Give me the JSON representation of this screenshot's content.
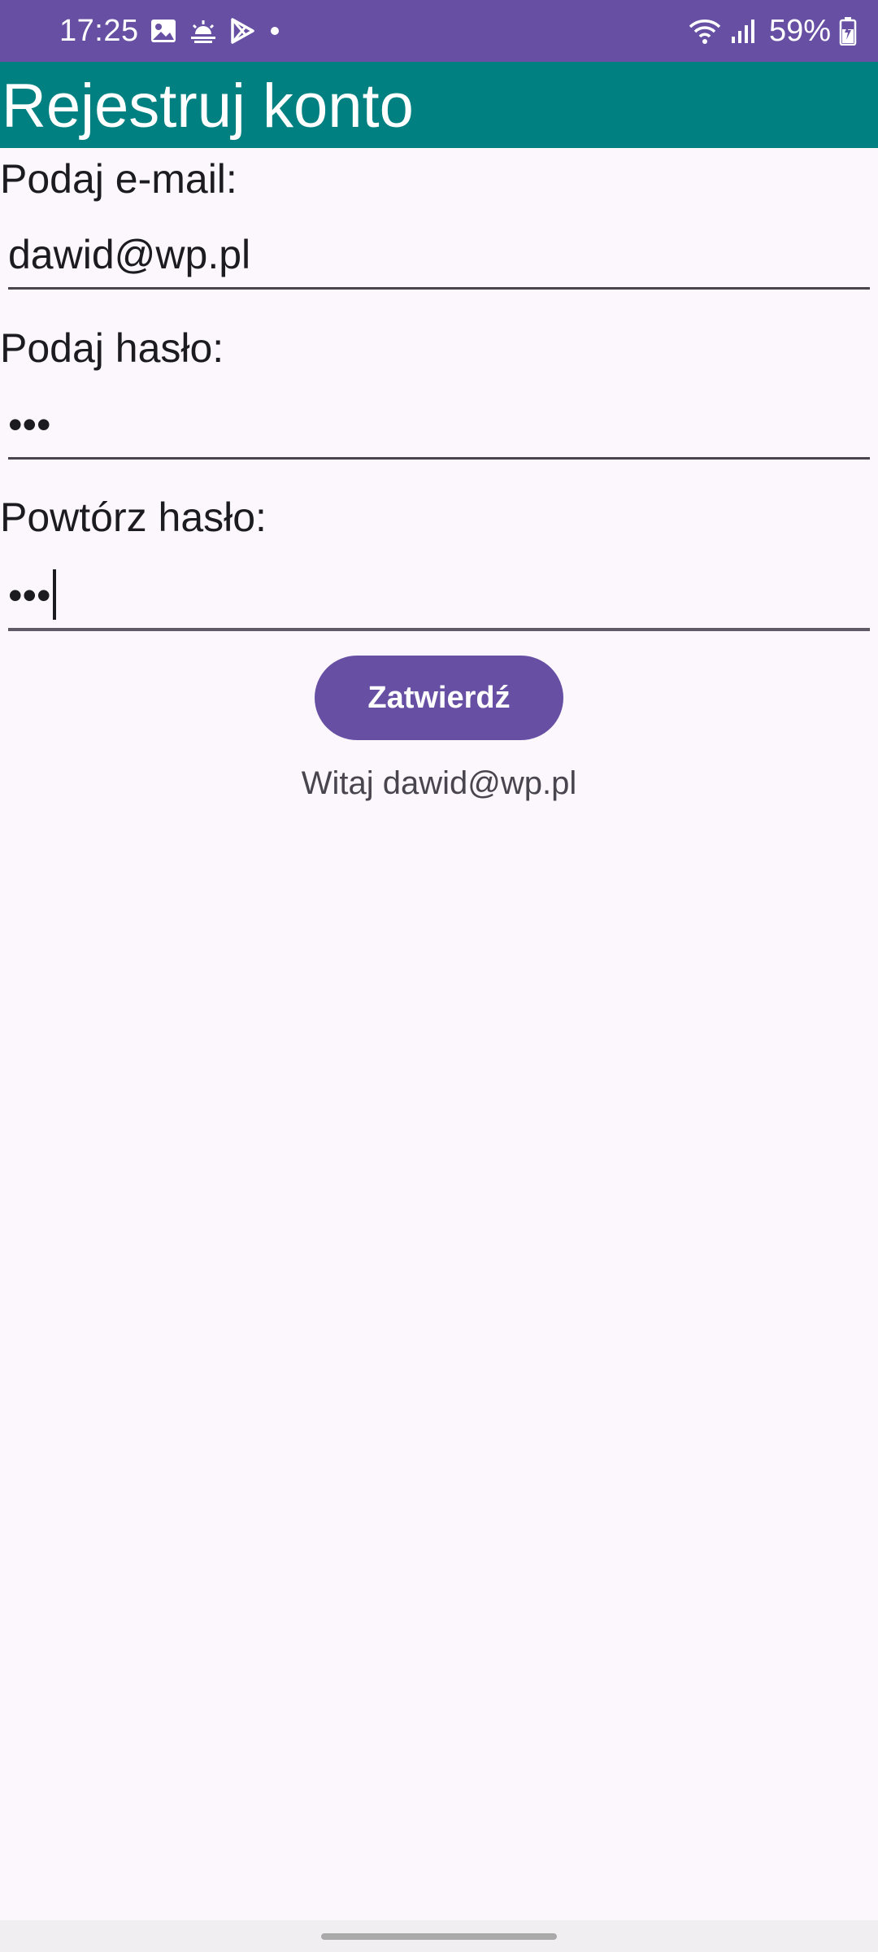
{
  "status_bar": {
    "time": "17:25",
    "battery": "59%",
    "icons_left": [
      "gallery-icon",
      "weather-icon",
      "play-store-icon",
      "dot-icon"
    ],
    "icons_right": [
      "wifi-icon",
      "signal-icon",
      "battery-icon"
    ],
    "background": "#6750A4"
  },
  "app_bar": {
    "title": "Rejestruj konto",
    "background": "#008080"
  },
  "form": {
    "email_label": "Podaj e-mail:",
    "email_value": "dawid@wp.pl",
    "password_label": "Podaj hasło:",
    "password_value": "•••",
    "repeat_password_label": "Powtórz hasło:",
    "repeat_password_value": "•••",
    "submit_label": "Zatwierdź",
    "submit_color": "#6750A4"
  },
  "result": {
    "welcome_text": "Witaj dawid@wp.pl"
  }
}
